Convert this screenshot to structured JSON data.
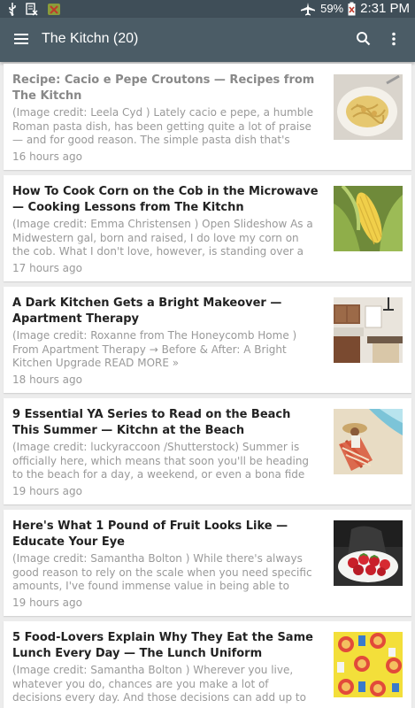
{
  "status": {
    "battery": "59%",
    "time": "2:31 PM"
  },
  "appbar": {
    "title": "The Kitchn (20)"
  },
  "articles": [
    {
      "title": "Recipe: Cacio e Pepe Croutons — Recipes from The Kitchn",
      "excerpt": "(Image credit: Leela Cyd ) Lately cacio e pepe, a humble Roman pasta dish, has been getting quite a lot of praise — and for good reason. The simple pasta dish that's tossed",
      "time": "16 hours ago",
      "thumb": "pasta-plate-thumbnail"
    },
    {
      "title": "How To Cook Corn on the Cob in the Microwave — Cooking Lessons from The Kitchn",
      "excerpt": "(Image credit: Emma Christensen ) Open Slideshow As a Midwestern gal, born and raised, I do love my corn on the cob. What I don't love, however, is standing over a boiling",
      "time": "17 hours ago",
      "thumb": "corn-cob-thumbnail"
    },
    {
      "title": "A Dark Kitchen Gets a Bright Makeover — Apartment Therapy",
      "excerpt": "(Image credit: Roxanne from The Honeycomb Home ) From Apartment Therapy → Before & After: A Bright Kitchen Upgrade READ MORE »",
      "time": "18 hours ago",
      "thumb": "kitchen-interior-thumbnail"
    },
    {
      "title": "9 Essential YA Series to Read on the Beach This Summer — Kitchn at the Beach",
      "excerpt": "(Image credit: luckyraccoon /Shutterstock) Summer is officially here, which means that soon you'll be heading to the beach for a day, a weekend, or even a bona fide",
      "time": "19 hours ago",
      "thumb": "beach-chair-thumbnail"
    },
    {
      "title": "Here's What 1 Pound of Fruit Looks Like — Educate Your Eye",
      "excerpt": "(Image credit: Samantha Bolton ) While there's always good reason to rely on the scale when you need specific amounts, I've found immense value in being able to",
      "time": "19 hours ago",
      "thumb": "strawberries-bowl-thumbnail"
    },
    {
      "title": "5 Food-Lovers Explain Why They Eat the Same Lunch Every Day — The Lunch Uniform",
      "excerpt": "(Image credit: Samantha Bolton ) Wherever you live, whatever you do, chances are you make a lot of decisions every day. And those decisions can add up to the point of",
      "time": "",
      "thumb": "lunch-pattern-thumbnail"
    }
  ],
  "colors": {
    "statusbar": "#3f4e58",
    "appbar": "#4b5c66",
    "background": "#ececec"
  }
}
